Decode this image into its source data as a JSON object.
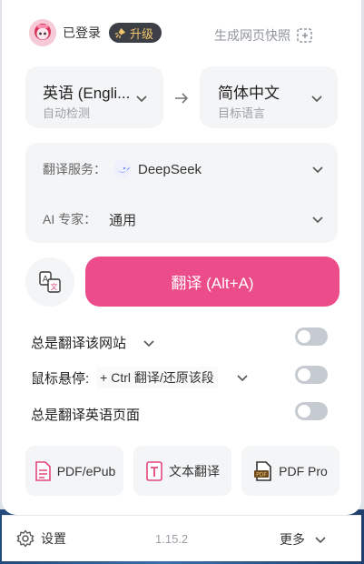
{
  "header": {
    "logged_in": "已登录",
    "upgrade": "升级",
    "snapshot": "生成网页快照"
  },
  "languages": {
    "source": {
      "name": "英语 (Engli...",
      "hint": "自动检测"
    },
    "target": {
      "name": "简体中文",
      "hint": "目标语言"
    }
  },
  "service": {
    "label": "翻译服务：",
    "value": "DeepSeek",
    "expert_label": "AI 专家：",
    "expert_value": "通用"
  },
  "translate_button": "翻译 (Alt+A)",
  "options": [
    {
      "label": "总是翻译该网站",
      "on": false
    },
    {
      "label": "鼠标悬停:",
      "shortcut": "+ Ctrl 翻译/还原该段",
      "on": false
    },
    {
      "label": "总是翻译英语页面",
      "on": false
    }
  ],
  "tools": {
    "pdf": "PDF/ePub",
    "text": "文本翻译",
    "pdf_pro": "PDF Pro"
  },
  "footer": {
    "settings": "设置",
    "version": "1.15.2",
    "more": "更多"
  },
  "colors": {
    "accent": "#ec4c89",
    "background": "#ffffff",
    "card": "#f4f5f7"
  }
}
